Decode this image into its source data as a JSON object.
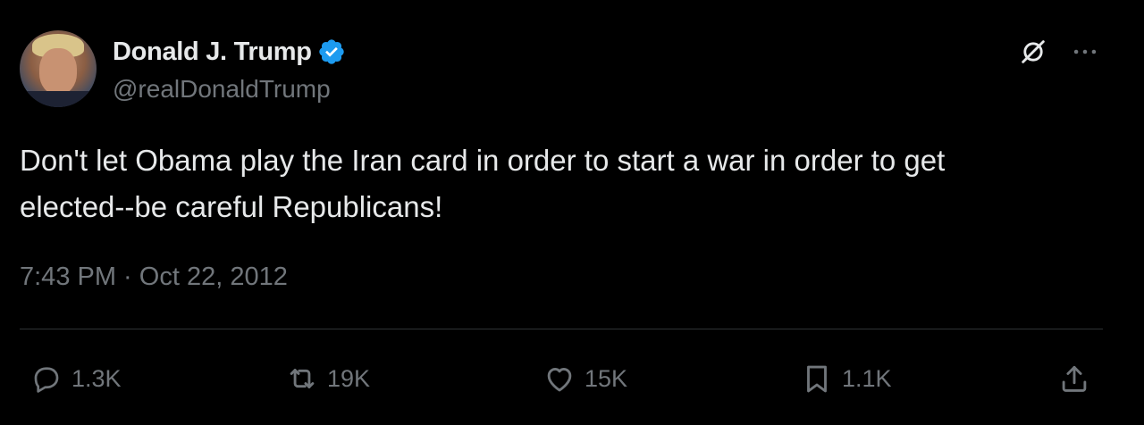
{
  "author": {
    "display_name": "Donald J. Trump",
    "handle": "@realDonaldTrump",
    "verified": true,
    "verified_color": "#1d9bf0"
  },
  "tweet": {
    "text": "Don't let Obama play the Iran card in order to start a war in order to get\nelected--be careful Republicans!",
    "timestamp": "7:43 PM · Oct 22, 2012"
  },
  "header_actions": {
    "grok_icon": "grok-icon",
    "more_icon": "more-dots-icon"
  },
  "actions": {
    "replies": "1.3K",
    "retweets": "19K",
    "likes": "15K",
    "bookmarks": "1.1K"
  },
  "colors": {
    "background": "#000000",
    "text_primary": "#e7e9ea",
    "text_secondary": "#71767b",
    "divider": "#2f3336"
  }
}
